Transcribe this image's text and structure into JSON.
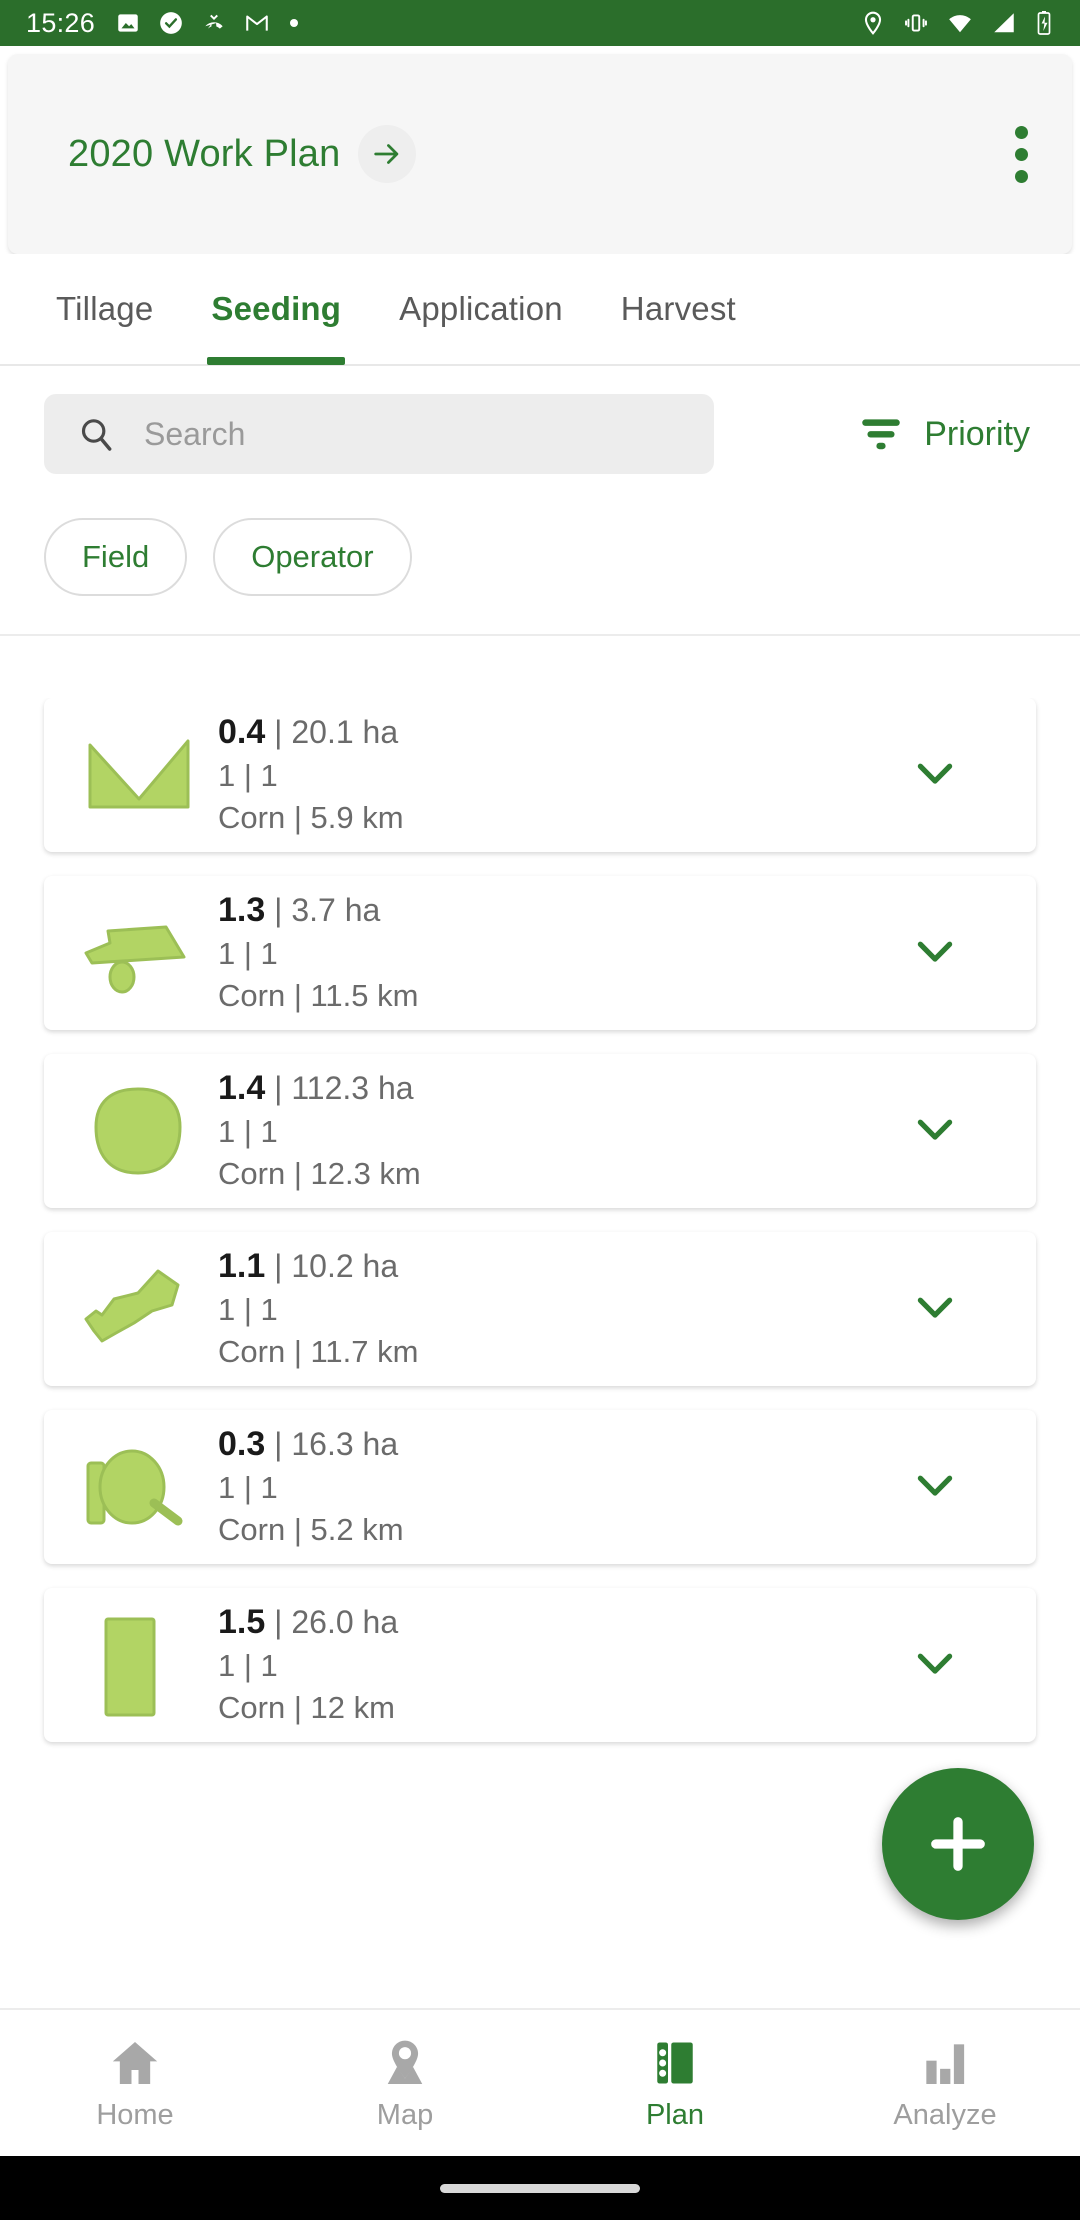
{
  "status_bar": {
    "time": "15:26",
    "left_icons": [
      "photo-icon",
      "check-circle-icon",
      "missed-call-icon",
      "gmail-icon",
      "dot-icon"
    ],
    "right_icons": [
      "location-icon",
      "vibrate-icon",
      "wifi-icon",
      "signal-icon",
      "battery-charging-icon"
    ],
    "background_color": "#2b6e2b"
  },
  "header": {
    "title": "2020 Work Plan",
    "go_icon": "arrow-right-icon",
    "overflow_icon": "kebab-menu-icon"
  },
  "tabs": [
    {
      "label": "Tillage",
      "active": false
    },
    {
      "label": "Seeding",
      "active": true
    },
    {
      "label": "Application",
      "active": false
    },
    {
      "label": "Harvest",
      "active": false
    }
  ],
  "search": {
    "placeholder": "Search",
    "value": "",
    "icon": "search-icon"
  },
  "sort": {
    "label": "Priority",
    "icon": "sort-filter-icon"
  },
  "filter_chips": [
    {
      "label": "Field"
    },
    {
      "label": "Operator"
    }
  ],
  "list": [
    {
      "priority": "0.4",
      "area": "20.1 ha",
      "counts": "1 | 1",
      "crop": "Corn",
      "distance": "5.9 km",
      "shape": "field-shape-chevron",
      "expand_icon": "chevron-down-icon"
    },
    {
      "priority": "1.3",
      "area": "3.7 ha",
      "counts": "1 | 1",
      "crop": "Corn",
      "distance": "11.5 km",
      "shape": "field-shape-arrow-dot",
      "expand_icon": "chevron-down-icon"
    },
    {
      "priority": "1.4",
      "area": "112.3 ha",
      "counts": "1 | 1",
      "crop": "Corn",
      "distance": "12.3 km",
      "shape": "field-shape-round",
      "expand_icon": "chevron-down-icon"
    },
    {
      "priority": "1.1",
      "area": "10.2 ha",
      "counts": "1 | 1",
      "crop": "Corn",
      "distance": "11.7 km",
      "shape": "field-shape-irregular",
      "expand_icon": "chevron-down-icon"
    },
    {
      "priority": "0.3",
      "area": "16.3 ha",
      "counts": "1 | 1",
      "crop": "Corn",
      "distance": "5.2 km",
      "shape": "field-shape-circle-bar",
      "expand_icon": "chevron-down-icon"
    },
    {
      "priority": "1.5",
      "area": "26.0 ha",
      "counts": "1 | 1",
      "crop": "Corn",
      "distance": "12 km",
      "shape": "field-shape-rectangle",
      "expand_icon": "chevron-down-icon"
    }
  ],
  "fab": {
    "icon": "plus-icon",
    "color": "#2e7d32"
  },
  "bottom_nav": [
    {
      "label": "Home",
      "icon": "home-icon",
      "active": false
    },
    {
      "label": "Map",
      "icon": "map-pin-icon",
      "active": false
    },
    {
      "label": "Plan",
      "icon": "plan-icon",
      "active": true
    },
    {
      "label": "Analyze",
      "icon": "bar-chart-icon",
      "active": false
    }
  ],
  "colors": {
    "brand_green": "#2e7d32",
    "status_bar_green": "#2b6e2b",
    "field_fill": "#b2d464",
    "field_stroke": "#9cbf56",
    "muted_text": "#6b6b6b"
  }
}
